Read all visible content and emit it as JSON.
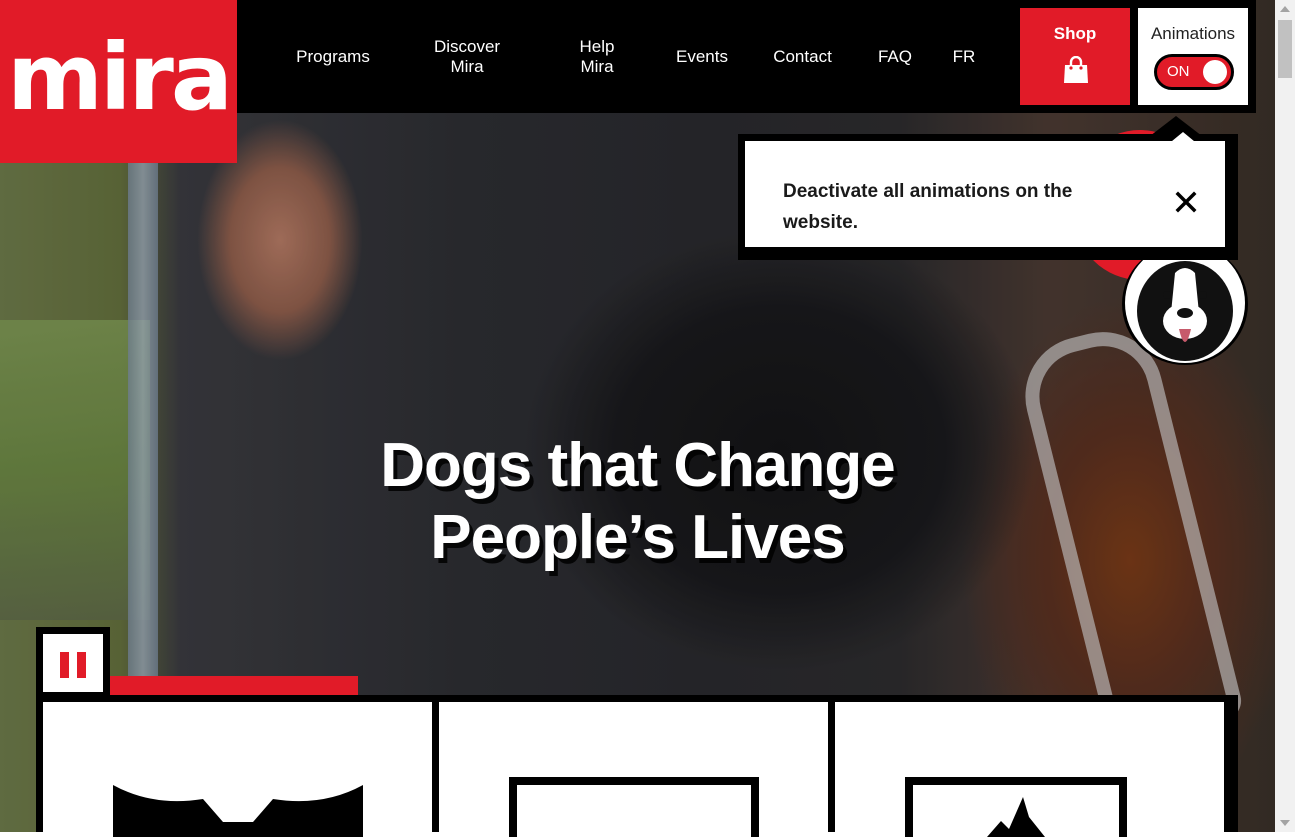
{
  "brand": {
    "logo_text": "mira",
    "color": "#e11b28"
  },
  "nav": {
    "items": [
      {
        "label": "Programs"
      },
      {
        "label": "Discover Mira",
        "line1": "Discover",
        "line2": "Mira"
      },
      {
        "label": "Help Mira",
        "line1": "Help",
        "line2": "Mira"
      },
      {
        "label": "Events"
      },
      {
        "label": "Contact"
      },
      {
        "label": "FAQ"
      },
      {
        "label": "FR"
      }
    ],
    "shop": {
      "label": "Shop",
      "icon": "shopping-bag-icon"
    },
    "animations": {
      "label": "Animations",
      "toggle_state": "ON"
    }
  },
  "tooltip": {
    "message": "Deactivate all animations on the website.",
    "close_icon": "close-icon"
  },
  "hero": {
    "title_line1": "Dogs that Change",
    "title_line2": "People’s Lives",
    "progress": 0.22
  },
  "cards": [
    {
      "icon": "card-illustration-icon"
    },
    {
      "icon": "card-illustration-icon"
    },
    {
      "icon": "card-illustration-icon"
    }
  ]
}
